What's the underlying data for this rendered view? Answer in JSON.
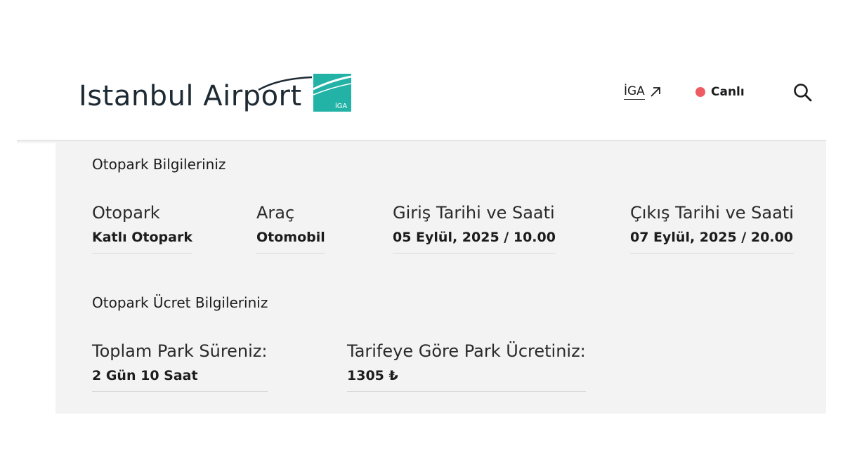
{
  "header": {
    "logo_text": "Istanbul Airport",
    "logo_badge": "İGA",
    "iga_link_label": "İGA",
    "live_label": "Canlı",
    "icons": {
      "external": "arrow-up-right-icon",
      "search": "search-icon",
      "live": "red-dot-icon"
    },
    "colors": {
      "logo_teal": "#22b3a6",
      "live_dot": "#ef5b63",
      "text": "#1e2a33"
    }
  },
  "parking_info": {
    "title": "Otopark Bilgileriniz",
    "fields": [
      {
        "label": "Otopark",
        "value": "Katlı Otopark"
      },
      {
        "label": "Araç",
        "value": "Otomobil"
      },
      {
        "label": "Giriş Tarihi ve Saati",
        "value": "05 Eylül, 2025 / 10.00"
      },
      {
        "label": "Çıkış Tarihi ve Saati",
        "value": "07 Eylül, 2025 / 20.00"
      }
    ]
  },
  "fee_info": {
    "title": "Otopark Ücret Bilgileriniz",
    "fields": [
      {
        "label": "Toplam Park Süreniz:",
        "value": "2 Gün 10 Saat"
      },
      {
        "label": "Tarifeye Göre Park Ücretiniz:",
        "value": "1305 ₺"
      }
    ]
  }
}
